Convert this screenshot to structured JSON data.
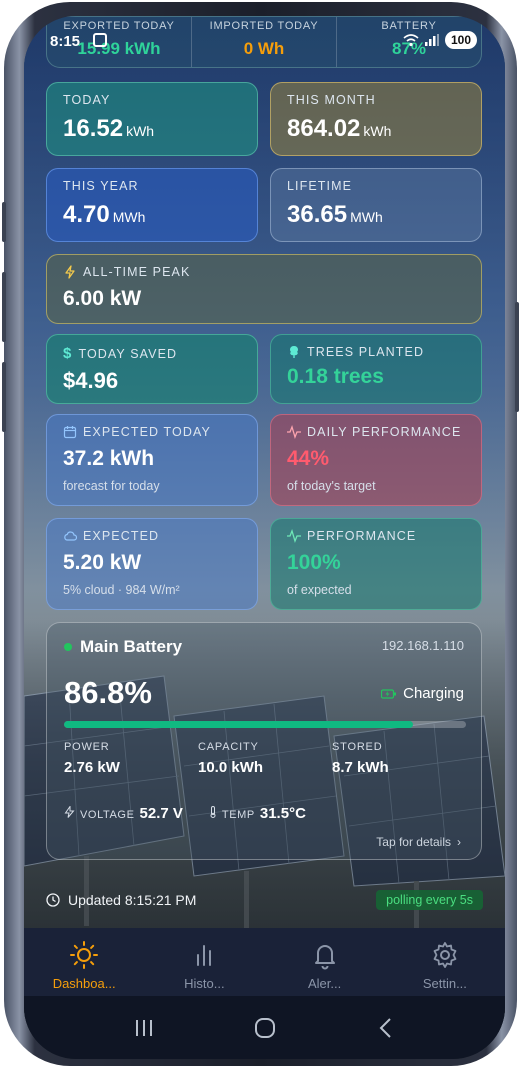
{
  "status_bar": {
    "time": "8:15",
    "battery": "100"
  },
  "summary": [
    {
      "label": "EXPORTED TODAY",
      "value": "15.99 kWh",
      "color": "#2fd39a"
    },
    {
      "label": "IMPORTED TODAY",
      "value": "0 Wh",
      "color": "#f59e0b"
    },
    {
      "label": "BATTERY",
      "value": "87%",
      "color": "#2fd39a"
    }
  ],
  "cards": {
    "today": {
      "label": "TODAY",
      "value": "16.52",
      "unit": "kWh"
    },
    "this_month": {
      "label": "THIS MONTH",
      "value": "864.02",
      "unit": "kWh"
    },
    "this_year": {
      "label": "THIS YEAR",
      "value": "4.70",
      "unit": "MWh"
    },
    "lifetime": {
      "label": "LIFETIME",
      "value": "36.65",
      "unit": "MWh"
    },
    "peak": {
      "label": "ALL-TIME PEAK",
      "value": "6.00 kW"
    },
    "saved": {
      "label": "TODAY SAVED",
      "value": "$4.96"
    },
    "trees": {
      "label": "TREES PLANTED",
      "value": "0.18 trees"
    },
    "expected_today": {
      "label": "EXPECTED TODAY",
      "value": "37.2 kWh",
      "sub": "forecast for today"
    },
    "daily_performance": {
      "label": "DAILY PERFORMANCE",
      "value": "44%",
      "sub": "of today's target"
    },
    "expected": {
      "label": "EXPECTED",
      "value": "5.20 kW",
      "sub": "5% cloud · 984 W/m²"
    },
    "performance": {
      "label": "PERFORMANCE",
      "value": "100%",
      "sub": "of expected"
    }
  },
  "battery": {
    "title": "Main Battery",
    "ip": "192.168.1.110",
    "percent": "86.8%",
    "level": 0.868,
    "status": "Charging",
    "power_label": "POWER",
    "power": "2.76 kW",
    "capacity_label": "CAPACITY",
    "capacity": "10.0 kWh",
    "stored_label": "STORED",
    "stored": "8.7 kWh",
    "voltage_label": "VOLTAGE",
    "voltage": "52.7 V",
    "temp_label": "TEMP",
    "temp": "31.5°C",
    "tap": "Tap for details"
  },
  "updated": "Updated 8:15:21 PM",
  "polling": "polling every 5s",
  "nav": [
    {
      "label": "Dashboa...",
      "icon": "sun-icon",
      "active": true
    },
    {
      "label": "Histo...",
      "icon": "bar-chart-icon",
      "active": false
    },
    {
      "label": "Aler...",
      "icon": "bell-icon",
      "active": false
    },
    {
      "label": "Settin...",
      "icon": "gear-icon",
      "active": false
    }
  ]
}
